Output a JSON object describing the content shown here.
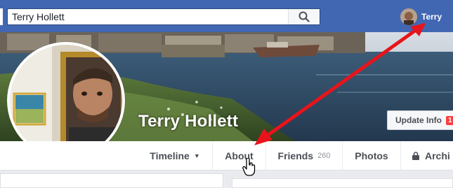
{
  "topbar": {
    "search_value": "Terry Hollett",
    "search_placeholder": "Search",
    "user_name": "Terry"
  },
  "cover": {
    "profile_name": "Terry Hollett",
    "update_info_label": "Update Info",
    "update_info_badge": "1"
  },
  "nav": {
    "tabs": [
      {
        "label": "Timeline",
        "has_caret": true
      },
      {
        "label": "About"
      },
      {
        "label": "Friends",
        "count": "260"
      },
      {
        "label": "Photos"
      },
      {
        "label": "Archi",
        "has_lock": true
      }
    ]
  },
  "annotation": {
    "arrow_color": "#e8141b"
  },
  "colors": {
    "topbar": "#4267b2",
    "page_bg": "#e9ebee"
  }
}
